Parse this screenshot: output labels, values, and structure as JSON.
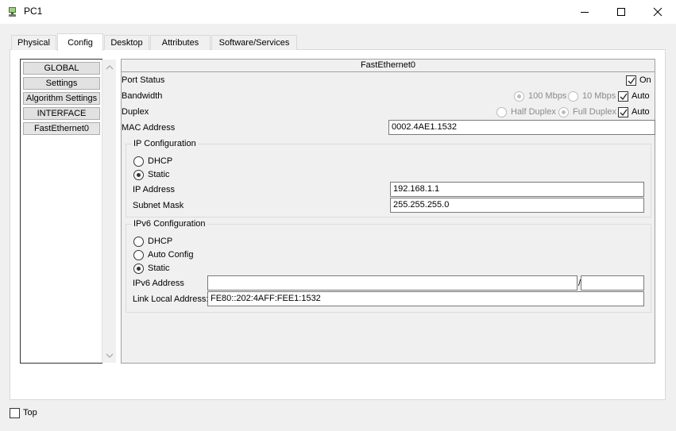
{
  "window": {
    "title": "PC1",
    "icon": "pc-icon"
  },
  "tabs": [
    {
      "label": "Physical"
    },
    {
      "label": "Config"
    },
    {
      "label": "Desktop"
    },
    {
      "label": "Attributes"
    },
    {
      "label": "Software/Services"
    }
  ],
  "active_tab": "Config",
  "sidebar": {
    "items": [
      {
        "label": "GLOBAL"
      },
      {
        "label": "Settings"
      },
      {
        "label": "Algorithm Settings"
      },
      {
        "label": "INTERFACE"
      },
      {
        "label": "FastEthernet0"
      }
    ],
    "selected": "FastEthernet0"
  },
  "panel": {
    "title": "FastEthernet0",
    "port_status": {
      "label": "Port Status",
      "on_label": "On",
      "checked": true
    },
    "bandwidth": {
      "label": "Bandwidth",
      "opt1": "100 Mbps",
      "opt2": "10 Mbps",
      "auto_label": "Auto",
      "auto_checked": true
    },
    "duplex": {
      "label": "Duplex",
      "opt1": "Half Duplex",
      "opt2": "Full Duplex",
      "auto_label": "Auto",
      "auto_checked": true
    },
    "mac": {
      "label": "MAC Address",
      "value": "0002.4AE1.1532"
    },
    "ipv4": {
      "title": "IP Configuration",
      "dhcp_label": "DHCP",
      "static_label": "Static",
      "mode": "Static",
      "ip_label": "IP Address",
      "ip_value": "192.168.1.1",
      "mask_label": "Subnet Mask",
      "mask_value": "255.255.255.0"
    },
    "ipv6": {
      "title": "IPv6 Configuration",
      "dhcp_label": "DHCP",
      "auto_label": "Auto Config",
      "static_label": "Static",
      "mode": "Static",
      "addr_label": "IPv6 Address",
      "addr_value": "",
      "prefix_sep": "/",
      "prefix_value": "",
      "link_local_label": "Link Local Address:",
      "link_local_value": "FE80::202:4AFF:FEE1:1532"
    }
  },
  "footer": {
    "top_label": "Top",
    "top_checked": false
  }
}
